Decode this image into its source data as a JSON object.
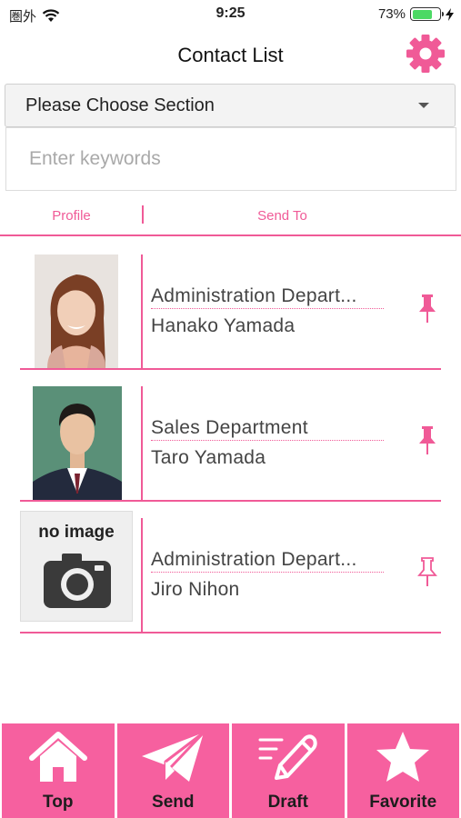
{
  "status_bar": {
    "carrier": "圏外",
    "time": "9:25",
    "battery_percent": "73%",
    "battery_level": 0.73
  },
  "header": {
    "title": "Contact List"
  },
  "section_select": {
    "selected": "Please Choose Section"
  },
  "search": {
    "placeholder": "Enter keywords",
    "value": ""
  },
  "columns": {
    "profile": "Profile",
    "send_to": "Send To"
  },
  "contacts": [
    {
      "department": "Administration Depart...",
      "name": "Hanako Yamada",
      "pinned": true,
      "photo": "female-portrait"
    },
    {
      "department": "Sales Department",
      "name": "Taro Yamada",
      "pinned": true,
      "photo": "male-portrait"
    },
    {
      "department": "Administration Depart...",
      "name": "Jiro Nihon",
      "pinned": false,
      "photo": "no-image",
      "no_image_label": "no image"
    }
  ],
  "tabs": [
    {
      "label": "Top",
      "icon": "home-icon"
    },
    {
      "label": "Send",
      "icon": "paper-plane-icon"
    },
    {
      "label": "Draft",
      "icon": "pencil-icon"
    },
    {
      "label": "Favorite",
      "icon": "star-icon"
    }
  ],
  "colors": {
    "accent": "#f05a97",
    "tab_background": "#f6609f",
    "battery": "#4cd964"
  }
}
